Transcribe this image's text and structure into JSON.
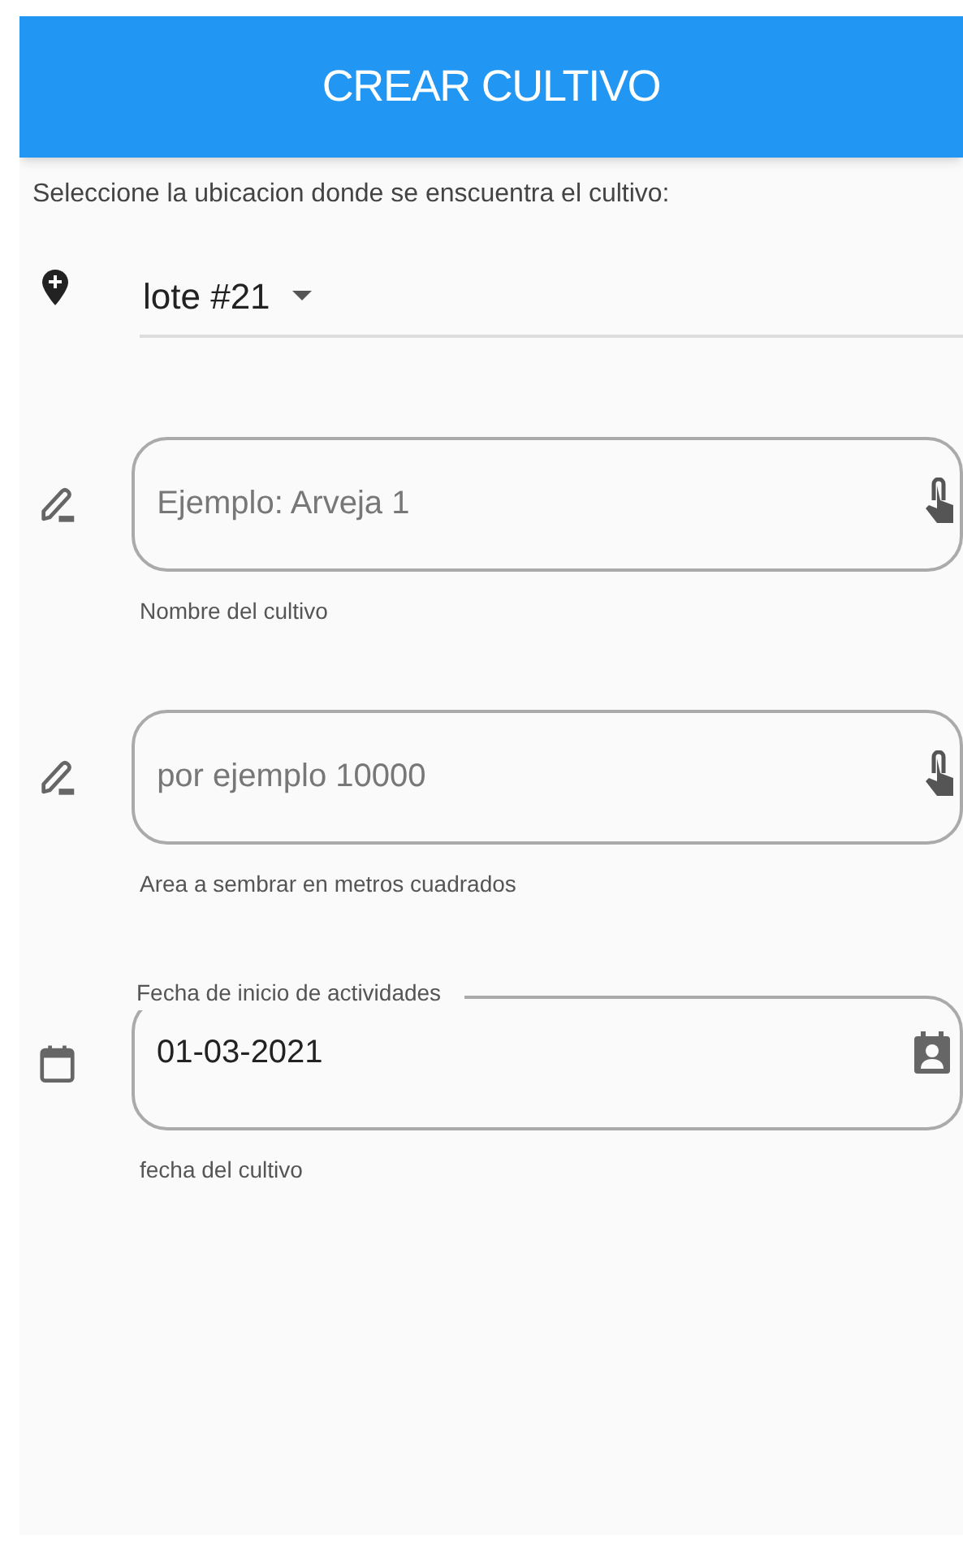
{
  "app_bar": {
    "title": "CREAR CULTIVO"
  },
  "location": {
    "prompt": "Seleccione la ubicacion donde se enscuentra el cultivo:",
    "value": "lote #21"
  },
  "fields": [
    {
      "kind": "text",
      "placeholder": "Ejemplo: Arveja 1",
      "helper": "Nombre del cultivo"
    },
    {
      "kind": "text",
      "placeholder": "por ejemplo 10000",
      "helper": "Area a sembrar en metros cuadrados"
    },
    {
      "kind": "date",
      "label": "Fecha de inicio de actividades",
      "value": "01-03-2021",
      "helper": "fecha del cultivo"
    }
  ]
}
